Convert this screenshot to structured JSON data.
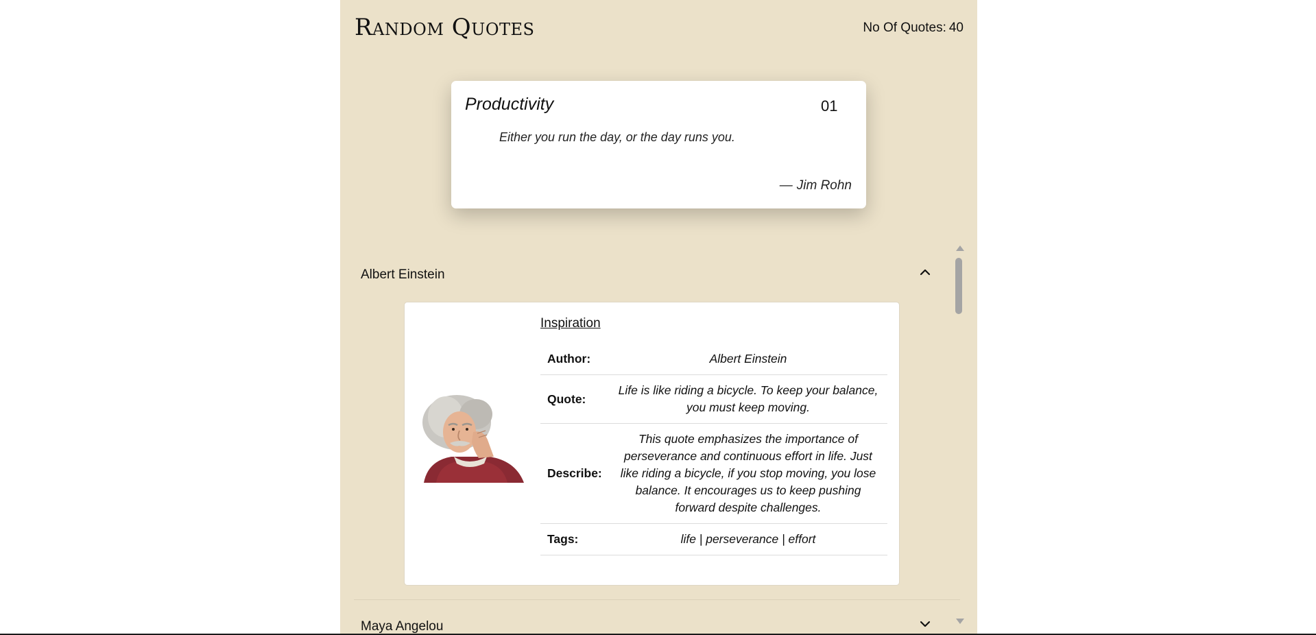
{
  "app": {
    "title": "Random Quotes",
    "quote_count_label": "No Of Quotes:",
    "quote_count": "40"
  },
  "featured": {
    "category": "Productivity",
    "index": "01",
    "quote": "Either you run the day, or the day runs you.",
    "dash": "—",
    "author": "Jim Rohn"
  },
  "accordion": {
    "items": [
      {
        "name": "Albert Einstein",
        "expanded": true,
        "chevron": "chevron-up-icon",
        "details": {
          "category": "Inspiration",
          "rows": [
            {
              "label": "Author:",
              "value": "Albert Einstein"
            },
            {
              "label": "Quote:",
              "value": "Life is like riding a bicycle. To keep your balance, you must keep moving."
            },
            {
              "label": "Describe:",
              "value": "This quote emphasizes the importance of perseverance and continuous effort in life. Just like riding a bicycle, if you stop moving, you lose balance. It encourages us to keep pushing forward despite challenges."
            },
            {
              "label": "Tags:",
              "value": "life | perseverance | effort"
            }
          ]
        }
      },
      {
        "name": "Maya Angelou",
        "expanded": false,
        "chevron": "chevron-down-icon"
      }
    ]
  },
  "colors": {
    "app_background": "#ebe1c9",
    "card_background": "#ffffff",
    "text": "#111111",
    "scrollbar": "#a4a4a4"
  }
}
